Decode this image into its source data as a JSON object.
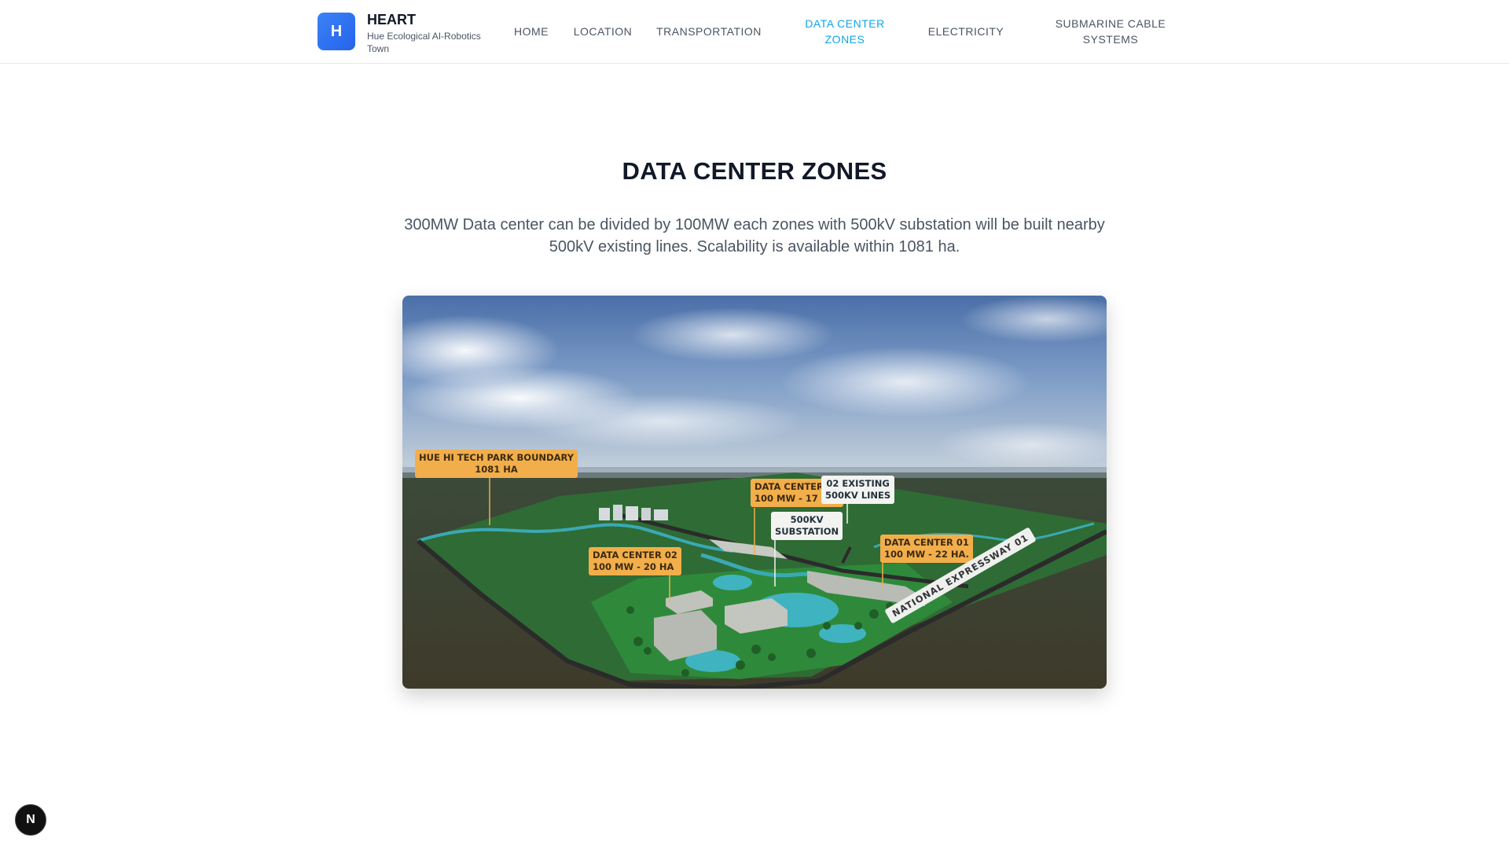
{
  "brand": {
    "logo_letter": "H",
    "title": "HEART",
    "subtitle": "Hue Ecological AI-Robotics Town"
  },
  "nav": [
    {
      "label": "HOME",
      "active": false
    },
    {
      "label": "LOCATION",
      "active": false
    },
    {
      "label": "TRANSPORTATION",
      "active": false
    },
    {
      "label": "DATA CENTER ZONES",
      "active": true
    },
    {
      "label": "ELECTRICITY",
      "active": false
    },
    {
      "label": "SUBMARINE CABLE SYSTEMS",
      "active": false
    }
  ],
  "main": {
    "title": "DATA CENTER ZONES",
    "description": "300MW Data center can be divided by 100MW each zones with 500kV substation will be built nearby 500kV existing lines. Scalability is available within 1081 ha."
  },
  "scene": {
    "labels": {
      "boundary_line1": "HUE HI TECH PARK BOUNDARY",
      "boundary_line2": "1081 HA",
      "dc03_line1": "DATA CENTER 03",
      "dc03_line2": "100 MW - 17 HA",
      "lines_line1": "02 EXISTING",
      "lines_line2": "500KV LINES",
      "substation_line1": "500KV",
      "substation_line2": "SUBSTATION",
      "dc01_line1": "DATA CENTER 01",
      "dc01_line2": "100 MW - 22 HA.",
      "dc02_line1": "DATA CENTER 02",
      "dc02_line2": "100 MW - 20 HA",
      "road": "NATIONAL EXPRESSWAY 01"
    }
  },
  "dev_badge": "N",
  "colors": {
    "accent": "#0ea5e9",
    "logo": "#2563eb",
    "callout_orange": "#f2ae4b",
    "callout_white": "#f3f4f1"
  }
}
